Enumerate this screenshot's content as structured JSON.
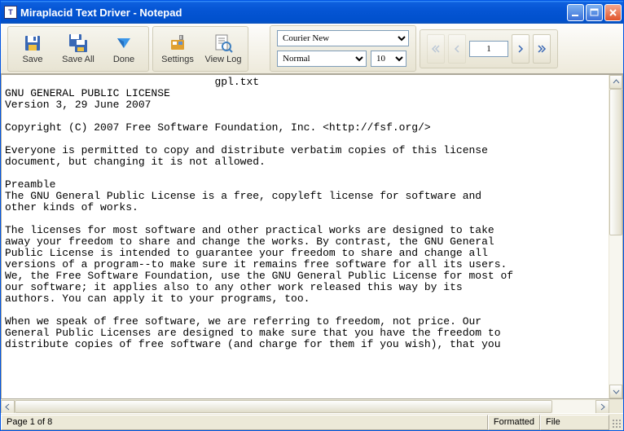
{
  "window": {
    "title": "Miraplacid Text Driver - Notepad"
  },
  "toolbar": {
    "save": "Save",
    "save_all": "Save All",
    "done": "Done",
    "settings": "Settings",
    "view_log": "View Log"
  },
  "font": {
    "family": "Courier New",
    "weight": "Normal",
    "size": "10"
  },
  "nav": {
    "page_input": "1"
  },
  "document": {
    "title_line": "                                 gpl.txt",
    "lines": [
      "GNU GENERAL PUBLIC LICENSE",
      "Version 3, 29 June 2007",
      "",
      "Copyright (C) 2007 Free Software Foundation, Inc. <http://fsf.org/>",
      "",
      "Everyone is permitted to copy and distribute verbatim copies of this license",
      "document, but changing it is not allowed.",
      "",
      "Preamble",
      "The GNU General Public License is a free, copyleft license for software and",
      "other kinds of works.",
      "",
      "The licenses for most software and other practical works are designed to take",
      "away your freedom to share and change the works. By contrast, the GNU General",
      "Public License is intended to guarantee your freedom to share and change all",
      "versions of a program--to make sure it remains free software for all its users.",
      "We, the Free Software Foundation, use the GNU General Public License for most of",
      "our software; it applies also to any other work released this way by its",
      "authors. You can apply it to your programs, too.",
      "",
      "When we speak of free software, we are referring to freedom, not price. Our",
      "General Public Licenses are designed to make sure that you have the freedom to",
      "distribute copies of free software (and charge for them if you wish), that you"
    ]
  },
  "status": {
    "page_info": "Page 1 of 8",
    "formatted": "Formatted",
    "file": "File"
  },
  "colors": {
    "titlebar_blue": "#0555d4",
    "close_red": "#e0542b",
    "chrome_bg": "#ece9d8"
  }
}
